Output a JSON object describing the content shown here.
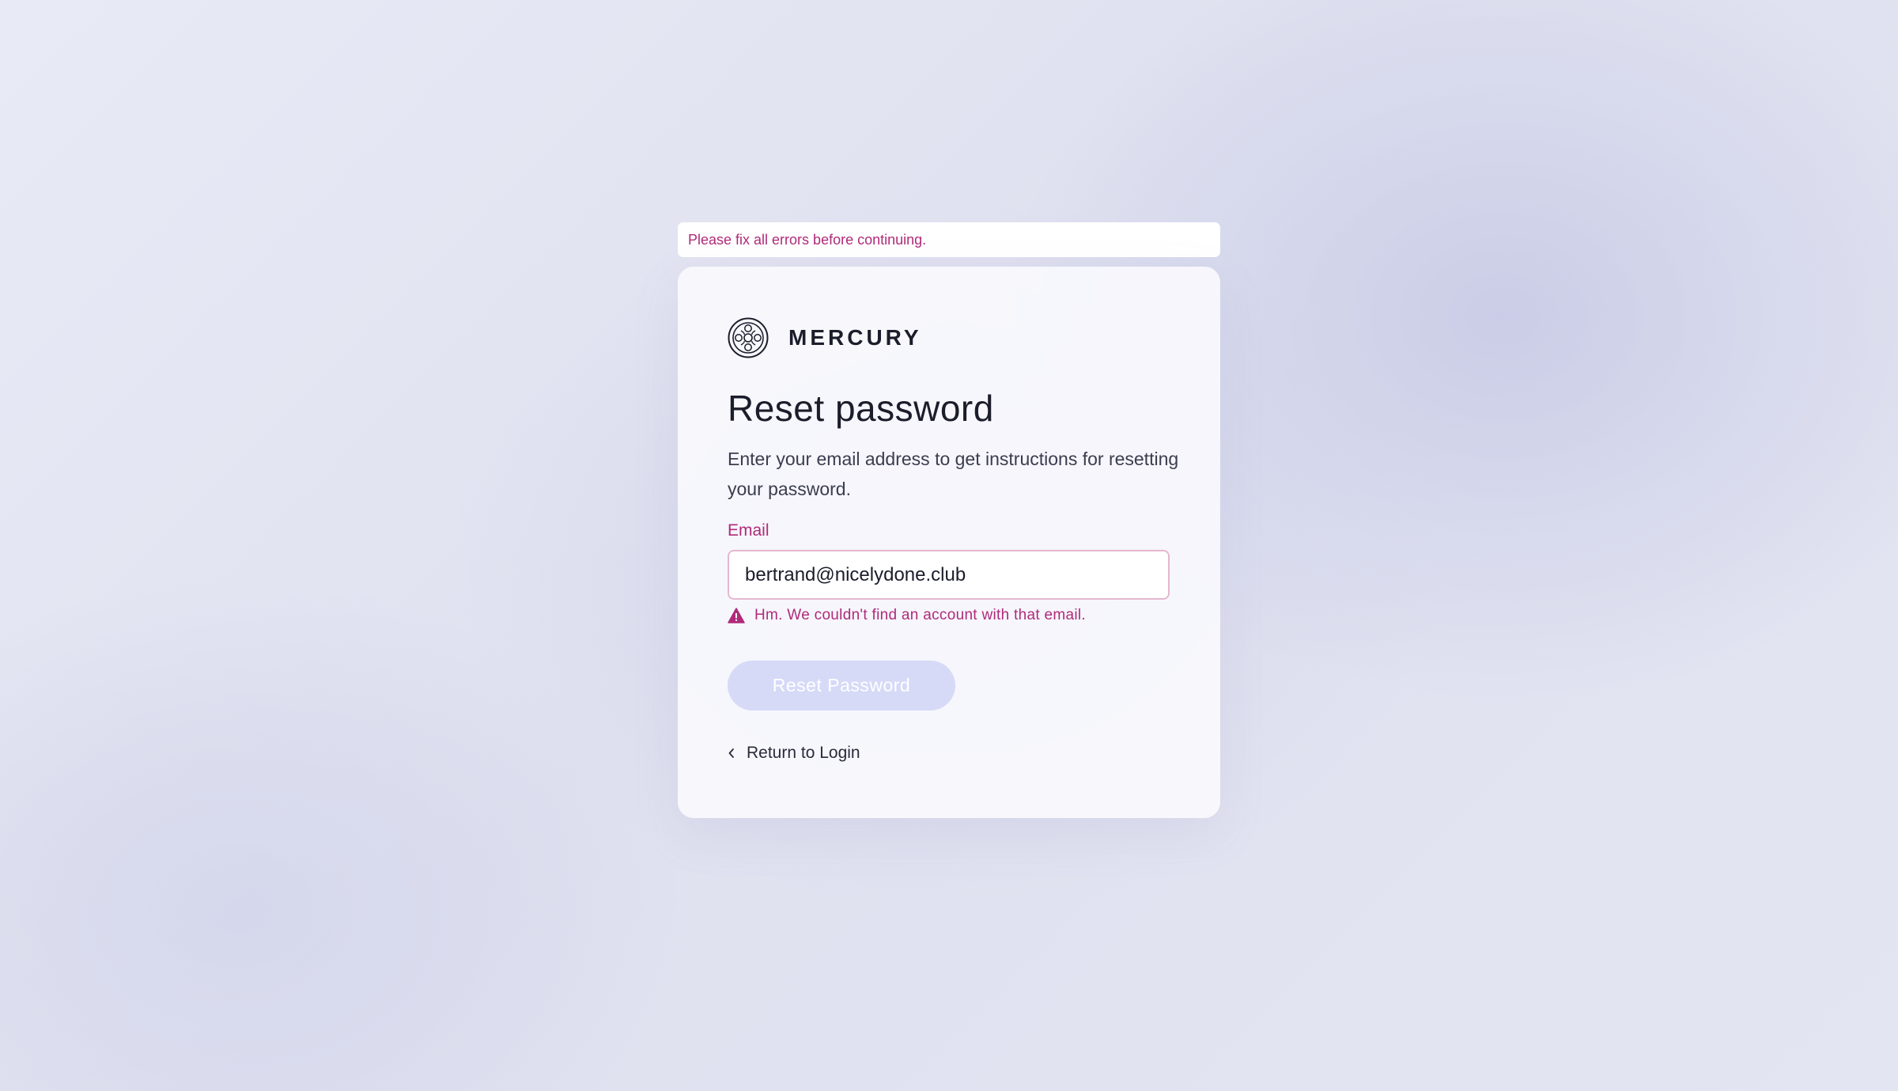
{
  "banner": {
    "message": "Please fix all errors before continuing."
  },
  "brand": {
    "name": "MERCURY",
    "icon": "mercury-logo-icon"
  },
  "form": {
    "title": "Reset password",
    "subtitle": "Enter your email address to get instructions for resetting your password.",
    "email_label": "Email",
    "email_value": "bertrand@nicelydone.club",
    "error_message": "Hm. We couldn't find an account with that email.",
    "error_icon": "warning-icon",
    "submit_label": "Reset Password",
    "return_label": "Return to Login",
    "return_icon": "chevron-left-icon"
  },
  "colors": {
    "error": "#b02a7a",
    "button_disabled": "#d6daf7",
    "text_primary": "#1c1d2b",
    "card_background": "#f9f9fd"
  }
}
